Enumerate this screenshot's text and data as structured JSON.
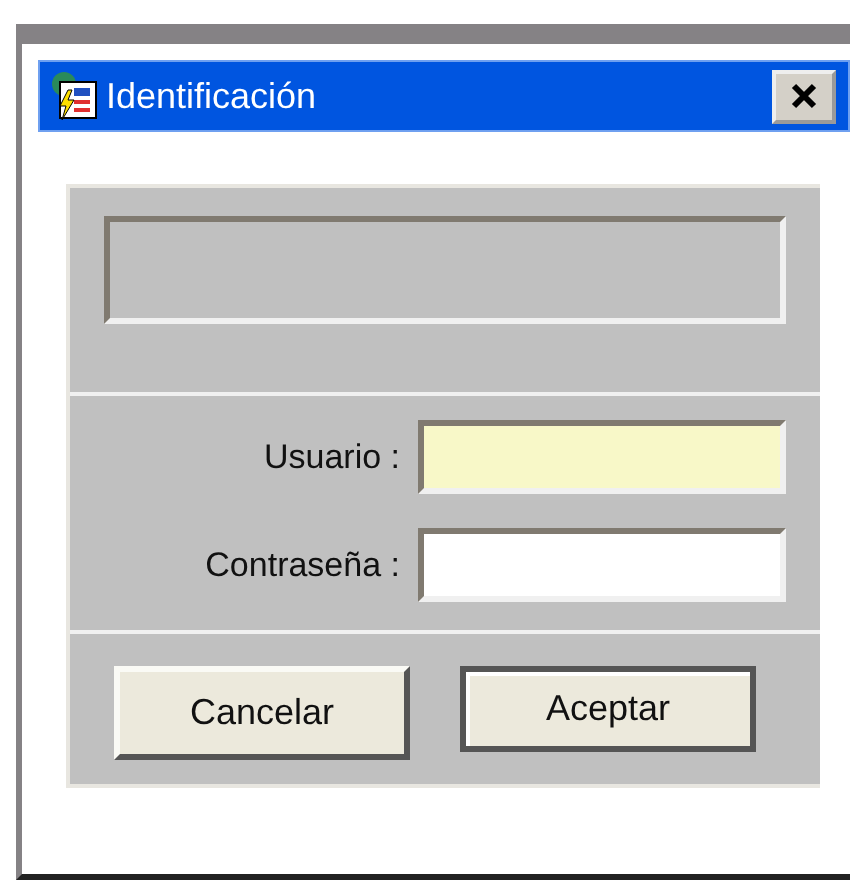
{
  "window": {
    "title": "Identificación"
  },
  "fields": [
    {
      "label": "Usuario :",
      "focused": true
    },
    {
      "label": "Contraseña :",
      "focused": false
    }
  ],
  "buttons": [
    {
      "label": "Cancelar",
      "default": false
    },
    {
      "label": "Aceptar",
      "default": true
    }
  ]
}
